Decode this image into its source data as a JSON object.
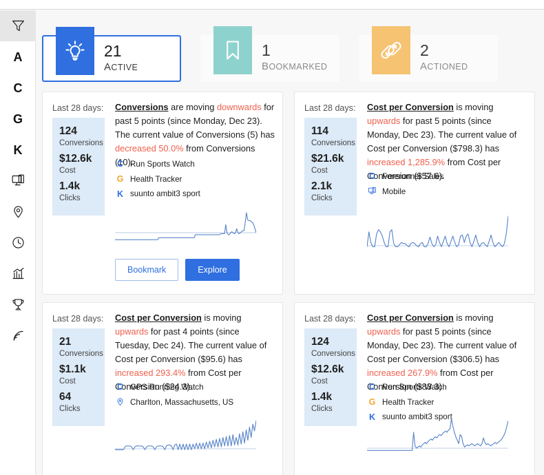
{
  "sidebar": {
    "items": [
      {
        "name": "filter",
        "kind": "icon",
        "glyph": "filter-icon",
        "selected": true
      },
      {
        "name": "accounts",
        "kind": "letter",
        "label": "A",
        "selected": false
      },
      {
        "name": "campaigns",
        "kind": "letter",
        "label": "C",
        "selected": false
      },
      {
        "name": "groups",
        "kind": "letter",
        "label": "G",
        "selected": false
      },
      {
        "name": "keywords",
        "kind": "letter",
        "label": "K",
        "selected": false
      },
      {
        "name": "devices",
        "kind": "icon",
        "glyph": "device-icon",
        "selected": false
      },
      {
        "name": "locations",
        "kind": "icon",
        "glyph": "location-pin-icon",
        "selected": false
      },
      {
        "name": "time",
        "kind": "icon",
        "glyph": "clock-icon",
        "selected": false
      },
      {
        "name": "performance",
        "kind": "icon",
        "glyph": "bar-chart-icon",
        "selected": false
      },
      {
        "name": "achievements",
        "kind": "icon",
        "glyph": "trophy-icon",
        "selected": false
      },
      {
        "name": "feed",
        "kind": "icon",
        "glyph": "rss-icon",
        "selected": false
      }
    ]
  },
  "tabs": [
    {
      "count": "21",
      "label": "Active",
      "icon": "lightbulb-icon",
      "color": "#2f6fe0",
      "active": true
    },
    {
      "count": "1",
      "label": "Bookmarked",
      "icon": "bookmark-icon",
      "color": "#8ed2cd",
      "active": false
    },
    {
      "count": "2",
      "label": "Actioned",
      "icon": "actioned-icon",
      "color": "#f5c372",
      "active": false
    }
  ],
  "colors": {
    "accent_blue": "#2f6fe0",
    "teal": "#8ed2cd",
    "amber": "#f5c372",
    "alert_red": "#f0604d",
    "stats_panel": "#ddeaf7",
    "spark_line": "#5b86c9"
  },
  "cards": [
    {
      "since_label": "Last 28 days:",
      "stats": [
        {
          "value": "124",
          "label": "Conversions"
        },
        {
          "value": "$12.6k",
          "label": "Cost"
        },
        {
          "value": "1.4k",
          "label": "Clicks"
        }
      ],
      "narrative": {
        "metric": "Conversions",
        "verb": " are moving ",
        "direction": "downwards",
        "mid": " for past 5 points (since Monday, Dec 23). The current value of Conversions (5) has ",
        "change": "decreased 50.0%",
        "tail": " from Conversions (10)."
      },
      "segments": [
        {
          "badge": "C",
          "badge_type": "blue",
          "label": "Run Sports Watch"
        },
        {
          "badge": "G",
          "badge_type": "orange",
          "label": "Health Tracker"
        },
        {
          "badge": "K",
          "badge_type": "blue",
          "label": "suunto ambit3 sport"
        }
      ],
      "actions": {
        "bookmark": "Bookmark",
        "explore": "Explore"
      },
      "chart_data": {
        "type": "line",
        "title": "Conversions sparkline",
        "values": [
          8,
          8,
          8,
          8,
          8,
          8,
          8,
          8,
          8,
          8,
          8,
          8,
          8,
          8,
          8,
          8,
          8,
          8,
          8,
          8,
          8,
          8,
          8,
          8,
          8,
          8,
          8,
          8,
          8,
          8,
          8,
          8,
          8,
          8,
          8,
          8,
          12,
          12,
          12,
          12,
          12,
          12,
          12,
          12,
          12,
          12,
          12,
          12,
          12,
          12,
          12,
          12,
          12,
          12,
          12,
          12,
          12,
          12,
          12,
          12,
          12,
          12,
          12,
          12,
          12,
          12,
          18,
          18,
          18,
          18,
          18,
          18,
          18,
          18,
          18,
          18,
          18,
          18,
          18,
          18,
          18,
          18,
          18,
          18,
          18,
          18,
          18,
          20,
          20,
          20,
          20,
          38,
          22,
          18,
          18,
          22,
          24,
          22,
          20,
          22,
          30,
          22,
          20,
          22,
          24,
          26,
          26,
          42,
          62,
          48,
          46,
          46,
          44,
          42,
          38,
          30,
          22
        ],
        "baseline": 22,
        "ylim": [
          0,
          66
        ],
        "grid": false
      }
    },
    {
      "since_label": "Last 28 days:",
      "stats": [
        {
          "value": "114",
          "label": "Conversions"
        },
        {
          "value": "$21.6k",
          "label": "Cost"
        },
        {
          "value": "2.1k",
          "label": "Clicks"
        }
      ],
      "narrative": {
        "metric": "Cost per Conversion",
        "verb": " is moving ",
        "direction": "upwards",
        "mid": " for past 5 points (since Monday, Dec 23). The current value of Cost per Conversion ($798.3) has ",
        "change": "increased 1,285.9%",
        "tail": " from Cost per Conversion ($57.6)."
      },
      "segments": [
        {
          "badge": "C",
          "badge_type": "blue",
          "label": "Forerunner Sales"
        },
        {
          "badge": "device",
          "badge_type": "icon",
          "label": "Mobile"
        }
      ],
      "actions": null,
      "chart_data": {
        "type": "line",
        "title": "Cost per Conversion sparkline",
        "values": [
          2,
          30,
          10,
          2,
          2,
          26,
          34,
          30,
          22,
          10,
          2,
          2,
          30,
          34,
          8,
          2,
          2,
          6,
          10,
          8,
          8,
          4,
          2,
          8,
          10,
          8,
          4,
          2,
          8,
          10,
          2,
          2,
          8,
          20,
          8,
          2,
          6,
          22,
          10,
          2,
          12,
          22,
          8,
          2,
          12,
          22,
          10,
          2,
          6,
          22,
          24,
          10,
          22,
          26,
          10,
          2,
          12,
          24,
          10,
          2,
          8,
          10,
          6,
          2,
          12,
          24,
          10,
          2,
          6,
          10,
          6,
          2,
          8,
          26,
          60
        ],
        "baseline": 4,
        "ylim": [
          0,
          62
        ],
        "grid": false
      }
    },
    {
      "since_label": "Last 28 days:",
      "stats": [
        {
          "value": "21",
          "label": "Conversions"
        },
        {
          "value": "$1.1k",
          "label": "Cost"
        },
        {
          "value": "64",
          "label": "Clicks"
        }
      ],
      "narrative": {
        "metric": "Cost per Conversion",
        "verb": " is moving ",
        "direction": "upwards",
        "mid": " for past 4 points (since Tuesday, Dec 24). The current value of Cost per Conversion ($95.6) has ",
        "change": "increased 293.4%",
        "tail": " from Cost per Conversion ($24.3)."
      },
      "segments": [
        {
          "badge": "C",
          "badge_type": "blue",
          "label": "GPS Running Watch"
        },
        {
          "badge": "location",
          "badge_type": "icon",
          "label": "Charlton, Massachusetts, US"
        }
      ],
      "actions": null,
      "chart_data": {
        "type": "line",
        "title": "Cost per Conversion sparkline",
        "values": [
          4,
          4,
          4,
          4,
          4,
          4,
          10,
          12,
          12,
          12,
          10,
          4,
          10,
          12,
          12,
          12,
          12,
          10,
          4,
          10,
          12,
          12,
          12,
          10,
          4,
          10,
          12,
          12,
          12,
          10,
          4,
          12,
          14,
          14,
          12,
          4,
          14,
          16,
          4,
          16,
          4,
          16,
          4,
          16,
          4,
          16,
          4,
          16,
          6,
          18,
          6,
          18,
          6,
          18,
          6,
          20,
          8,
          22,
          8,
          24,
          10,
          26,
          10,
          28,
          10,
          30,
          12,
          32,
          12,
          34,
          12,
          36,
          14,
          30,
          14,
          38,
          16,
          42,
          18,
          46,
          24,
          52,
          30,
          58,
          44,
          66
        ],
        "baseline": 6,
        "ylim": [
          0,
          70
        ],
        "grid": false
      }
    },
    {
      "since_label": "Last 28 days:",
      "stats": [
        {
          "value": "124",
          "label": "Conversions"
        },
        {
          "value": "$12.6k",
          "label": "Cost"
        },
        {
          "value": "1.4k",
          "label": "Clicks"
        }
      ],
      "narrative": {
        "metric": "Cost per Conversion",
        "verb": " is moving ",
        "direction": "upwards",
        "mid": " for past 5 points (since Monday, Dec 23). The current value of Cost per Conversion ($306.5) has ",
        "change": "increased 267.9%",
        "tail": " from Cost per Conversion ($83.3)."
      },
      "segments": [
        {
          "badge": "C",
          "badge_type": "blue",
          "label": "Run Sports Watch"
        },
        {
          "badge": "G",
          "badge_type": "orange",
          "label": "Health Tracker"
        },
        {
          "badge": "K",
          "badge_type": "blue",
          "label": "suunto ambit3 sport"
        }
      ],
      "actions": null,
      "chart_data": {
        "type": "line",
        "title": "Cost per Conversion sparkline",
        "values": [
          2,
          2,
          2,
          2,
          2,
          2,
          2,
          2,
          2,
          2,
          2,
          2,
          2,
          2,
          2,
          2,
          2,
          2,
          2,
          2,
          2,
          2,
          2,
          2,
          2,
          2,
          2,
          2,
          2,
          2,
          2,
          2,
          34,
          10,
          6,
          8,
          10,
          8,
          12,
          14,
          16,
          14,
          18,
          20,
          22,
          20,
          24,
          26,
          24,
          28,
          30,
          28,
          32,
          34,
          36,
          34,
          38,
          40,
          58,
          44,
          34,
          26,
          20,
          14,
          30,
          26,
          14,
          8,
          10,
          12,
          10,
          12,
          14,
          12,
          10,
          12,
          14,
          12,
          10,
          14,
          24,
          16,
          12,
          14,
          12,
          10,
          12,
          14,
          16,
          14,
          16,
          18,
          20,
          24,
          28,
          34,
          44,
          54
        ],
        "baseline": 6,
        "ylim": [
          0,
          58
        ],
        "grid": false
      }
    }
  ]
}
